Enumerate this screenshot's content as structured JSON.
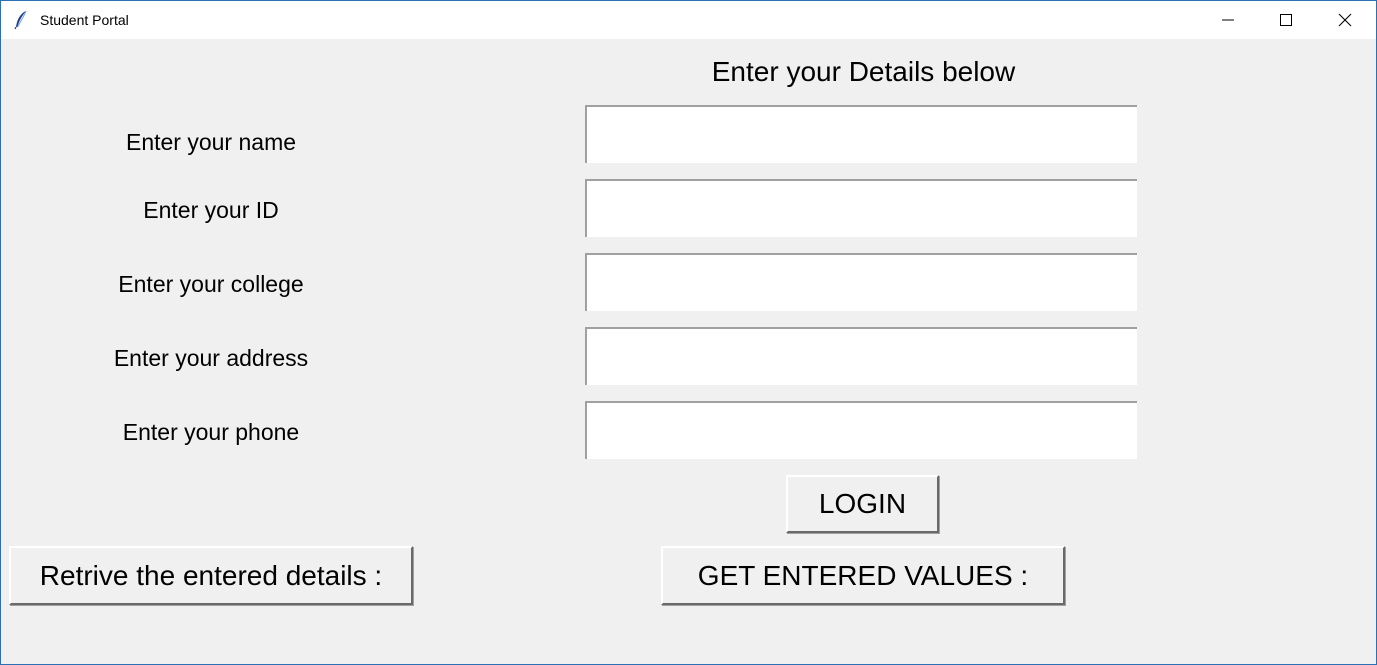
{
  "window": {
    "title": "Student Portal",
    "app_icon": "feather-icon",
    "controls": [
      "minimize-icon",
      "maximize-icon",
      "close-icon"
    ]
  },
  "form": {
    "heading": "Enter your Details below",
    "fields": [
      {
        "label": "Enter your name",
        "value": ""
      },
      {
        "label": "Enter your ID",
        "value": ""
      },
      {
        "label": "Enter your college",
        "value": ""
      },
      {
        "label": "Enter your address",
        "value": ""
      },
      {
        "label": "Enter your phone",
        "value": ""
      }
    ]
  },
  "buttons": {
    "login": "LOGIN",
    "retrieve": "Retrive the entered details :",
    "get_values": "GET ENTERED VALUES :"
  },
  "colors": {
    "window_background": "#f0f0f0",
    "titlebar_background": "#ffffff",
    "entry_background": "#ffffff",
    "window_border": "#2b6fb5"
  }
}
